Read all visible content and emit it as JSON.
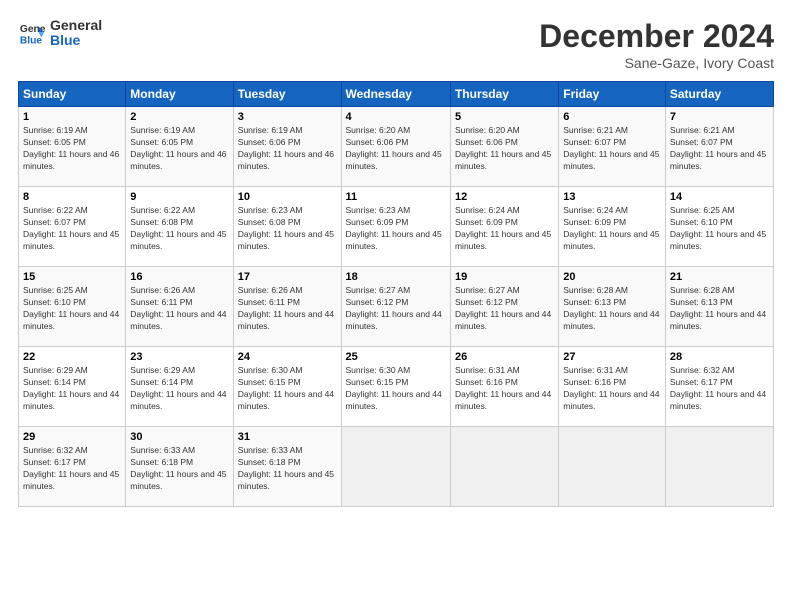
{
  "logo": {
    "line1": "General",
    "line2": "Blue"
  },
  "title": "December 2024",
  "subtitle": "Sane-Gaze, Ivory Coast",
  "calendar": {
    "headers": [
      "Sunday",
      "Monday",
      "Tuesday",
      "Wednesday",
      "Thursday",
      "Friday",
      "Saturday"
    ],
    "weeks": [
      [
        {
          "day": "1",
          "sunrise": "6:19 AM",
          "sunset": "6:05 PM",
          "daylight": "11 hours and 46 minutes."
        },
        {
          "day": "2",
          "sunrise": "6:19 AM",
          "sunset": "6:05 PM",
          "daylight": "11 hours and 46 minutes."
        },
        {
          "day": "3",
          "sunrise": "6:19 AM",
          "sunset": "6:06 PM",
          "daylight": "11 hours and 46 minutes."
        },
        {
          "day": "4",
          "sunrise": "6:20 AM",
          "sunset": "6:06 PM",
          "daylight": "11 hours and 45 minutes."
        },
        {
          "day": "5",
          "sunrise": "6:20 AM",
          "sunset": "6:06 PM",
          "daylight": "11 hours and 45 minutes."
        },
        {
          "day": "6",
          "sunrise": "6:21 AM",
          "sunset": "6:07 PM",
          "daylight": "11 hours and 45 minutes."
        },
        {
          "day": "7",
          "sunrise": "6:21 AM",
          "sunset": "6:07 PM",
          "daylight": "11 hours and 45 minutes."
        }
      ],
      [
        {
          "day": "8",
          "sunrise": "6:22 AM",
          "sunset": "6:07 PM",
          "daylight": "11 hours and 45 minutes."
        },
        {
          "day": "9",
          "sunrise": "6:22 AM",
          "sunset": "6:08 PM",
          "daylight": "11 hours and 45 minutes."
        },
        {
          "day": "10",
          "sunrise": "6:23 AM",
          "sunset": "6:08 PM",
          "daylight": "11 hours and 45 minutes."
        },
        {
          "day": "11",
          "sunrise": "6:23 AM",
          "sunset": "6:09 PM",
          "daylight": "11 hours and 45 minutes."
        },
        {
          "day": "12",
          "sunrise": "6:24 AM",
          "sunset": "6:09 PM",
          "daylight": "11 hours and 45 minutes."
        },
        {
          "day": "13",
          "sunrise": "6:24 AM",
          "sunset": "6:09 PM",
          "daylight": "11 hours and 45 minutes."
        },
        {
          "day": "14",
          "sunrise": "6:25 AM",
          "sunset": "6:10 PM",
          "daylight": "11 hours and 45 minutes."
        }
      ],
      [
        {
          "day": "15",
          "sunrise": "6:25 AM",
          "sunset": "6:10 PM",
          "daylight": "11 hours and 44 minutes."
        },
        {
          "day": "16",
          "sunrise": "6:26 AM",
          "sunset": "6:11 PM",
          "daylight": "11 hours and 44 minutes."
        },
        {
          "day": "17",
          "sunrise": "6:26 AM",
          "sunset": "6:11 PM",
          "daylight": "11 hours and 44 minutes."
        },
        {
          "day": "18",
          "sunrise": "6:27 AM",
          "sunset": "6:12 PM",
          "daylight": "11 hours and 44 minutes."
        },
        {
          "day": "19",
          "sunrise": "6:27 AM",
          "sunset": "6:12 PM",
          "daylight": "11 hours and 44 minutes."
        },
        {
          "day": "20",
          "sunrise": "6:28 AM",
          "sunset": "6:13 PM",
          "daylight": "11 hours and 44 minutes."
        },
        {
          "day": "21",
          "sunrise": "6:28 AM",
          "sunset": "6:13 PM",
          "daylight": "11 hours and 44 minutes."
        }
      ],
      [
        {
          "day": "22",
          "sunrise": "6:29 AM",
          "sunset": "6:14 PM",
          "daylight": "11 hours and 44 minutes."
        },
        {
          "day": "23",
          "sunrise": "6:29 AM",
          "sunset": "6:14 PM",
          "daylight": "11 hours and 44 minutes."
        },
        {
          "day": "24",
          "sunrise": "6:30 AM",
          "sunset": "6:15 PM",
          "daylight": "11 hours and 44 minutes."
        },
        {
          "day": "25",
          "sunrise": "6:30 AM",
          "sunset": "6:15 PM",
          "daylight": "11 hours and 44 minutes."
        },
        {
          "day": "26",
          "sunrise": "6:31 AM",
          "sunset": "6:16 PM",
          "daylight": "11 hours and 44 minutes."
        },
        {
          "day": "27",
          "sunrise": "6:31 AM",
          "sunset": "6:16 PM",
          "daylight": "11 hours and 44 minutes."
        },
        {
          "day": "28",
          "sunrise": "6:32 AM",
          "sunset": "6:17 PM",
          "daylight": "11 hours and 44 minutes."
        }
      ],
      [
        {
          "day": "29",
          "sunrise": "6:32 AM",
          "sunset": "6:17 PM",
          "daylight": "11 hours and 45 minutes."
        },
        {
          "day": "30",
          "sunrise": "6:33 AM",
          "sunset": "6:18 PM",
          "daylight": "11 hours and 45 minutes."
        },
        {
          "day": "31",
          "sunrise": "6:33 AM",
          "sunset": "6:18 PM",
          "daylight": "11 hours and 45 minutes."
        },
        null,
        null,
        null,
        null
      ]
    ]
  },
  "labels": {
    "sunrise_prefix": "Sunrise: ",
    "sunset_prefix": "Sunset: ",
    "daylight_prefix": "Daylight: "
  }
}
